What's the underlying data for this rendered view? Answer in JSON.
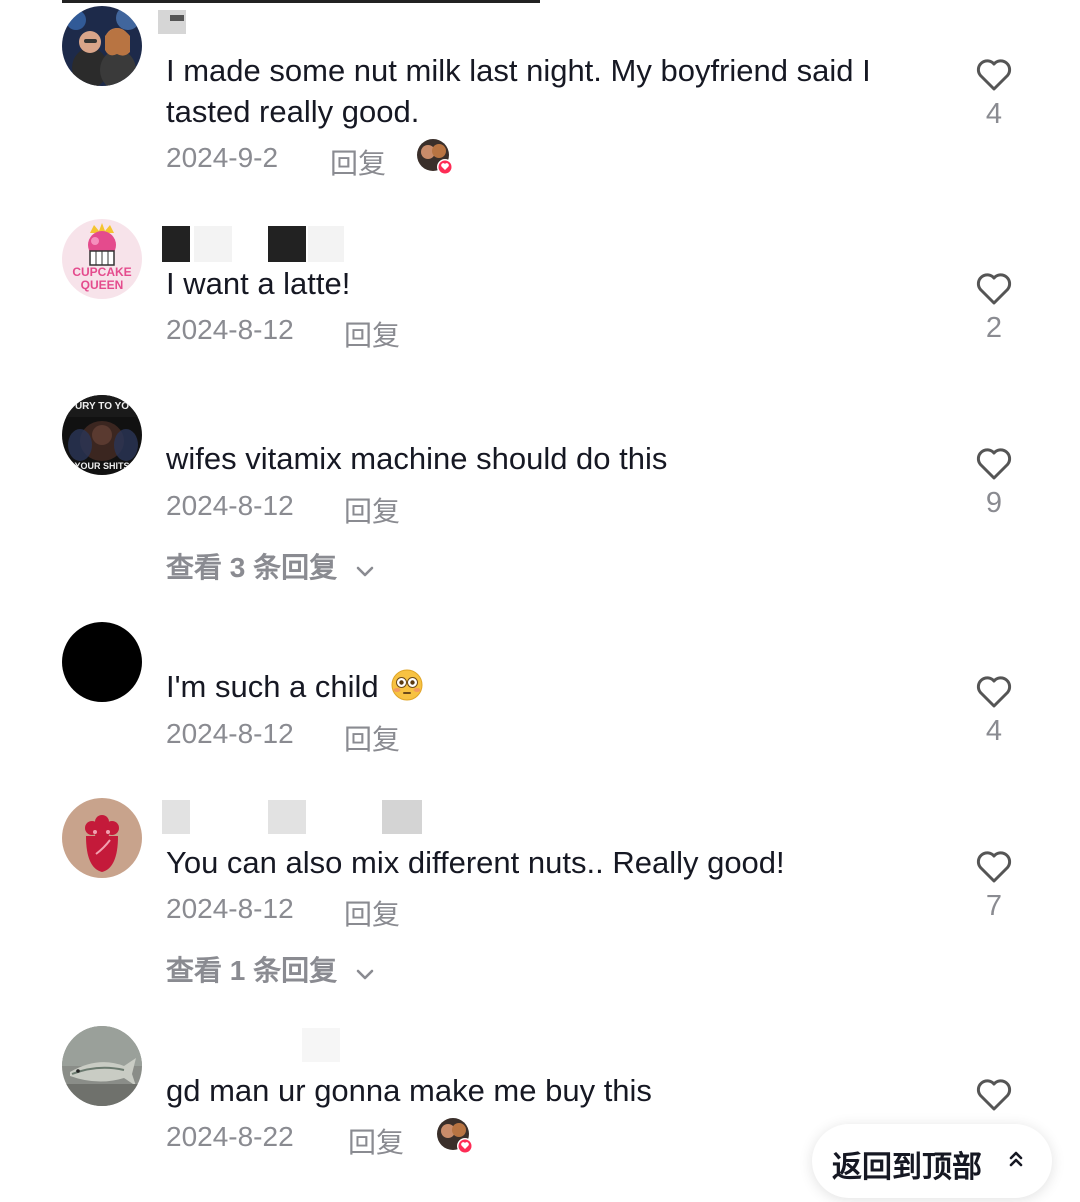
{
  "comments": [
    {
      "text": "I made some nut milk last night. My boyfriend said I tasted really good.",
      "date": "2024-9-2",
      "reply": "回复",
      "likes": "4",
      "creator_liked": true
    },
    {
      "text": "I want a latte!",
      "date": "2024-8-12",
      "reply": "回复",
      "likes": "2",
      "avatar_text_top": "CUPCAKE",
      "avatar_text_bottom": "QUEEN"
    },
    {
      "text": "wifes vitamix machine should do this",
      "date": "2024-8-12",
      "reply": "回复",
      "likes": "9",
      "view_replies": "查看 3 条回复",
      "avatar_text_top": "URY TO YO",
      "avatar_text_bottom": "YOUR SHITS"
    },
    {
      "text": "I'm such a child",
      "date": "2024-8-12",
      "reply": "回复",
      "likes": "4"
    },
    {
      "text": "You can also mix different nuts.. Really good!",
      "date": "2024-8-12",
      "reply": "回复",
      "likes": "7",
      "view_replies": "查看 1 条回复"
    },
    {
      "text": "gd man ur gonna make me buy this",
      "date": "2024-8-22",
      "reply": "回复",
      "likes": "",
      "creator_liked": true
    }
  ],
  "back_to_top": "返回到顶部",
  "colors": {
    "text": "#161823",
    "secondary": "#8a8b91",
    "heart_outline": "#555555",
    "creator_heart": "#fe2c55"
  },
  "icons": [
    "heart-outline-icon",
    "chevron-down-icon",
    "double-chevron-up-icon",
    "flushed-face-emoji"
  ]
}
